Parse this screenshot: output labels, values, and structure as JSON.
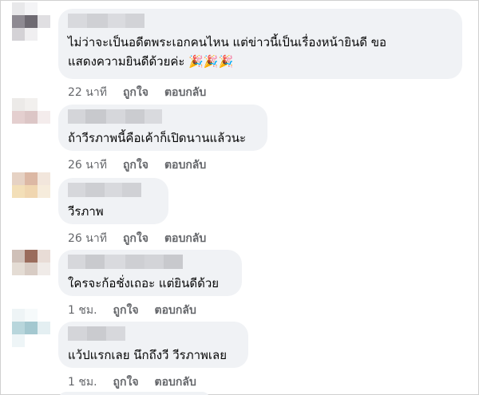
{
  "comments": [
    {
      "text": "ไม่ว่าจะเป็นอดีตพระเอกคนไหน แต่ข่าวนี้เป็นเรื่องหน้ายินดี ขอ\nแสดงความยินดีด้วยค่ะ 🎉🎉🎉",
      "time": "22 นาที",
      "like": "ถูกใจ",
      "reply": "ตอบกลับ"
    },
    {
      "text": "ถ้าวีรภาพนี้คือเค้าก็เปิดนานแล้วนะ",
      "time": "26 นาที",
      "like": "ถูกใจ",
      "reply": "ตอบกลับ"
    },
    {
      "text": "วีรภาพ",
      "time": "26 นาที",
      "like": "ถูกใจ",
      "reply": "ตอบกลับ"
    },
    {
      "text": "ใครจะก้อชั่งเถอะ แต่ยินดีด้วย",
      "time": "1 ชม.",
      "like": "ถูกใจ",
      "reply": "ตอบกลับ"
    },
    {
      "text": "แว้ปแรกเลย นึกถึงวี วีรภาพเลย",
      "time": "1 ชม.",
      "like": "ถูกใจ",
      "reply": "ตอบกลับ"
    }
  ],
  "colors": {
    "bubble": "#f0f2f5",
    "meta": "#65676b",
    "text": "#050505"
  }
}
